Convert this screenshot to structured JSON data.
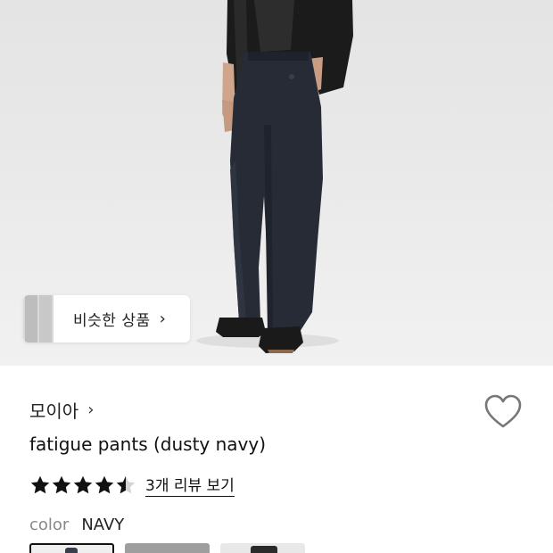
{
  "hero": {
    "image": "product-photo-person-in-navy-pants"
  },
  "similar": {
    "label": "비슷한 상품",
    "arrow": "›"
  },
  "brand": {
    "name": "모이아",
    "arrow": "›"
  },
  "product": {
    "title": "fatigue pants (dusty navy)"
  },
  "rating": {
    "stars": 4.5,
    "reviews_link": "3개 리뷰 보기"
  },
  "color": {
    "label": "color",
    "value": "NAVY",
    "options": [
      "navy-swatch",
      "gray-swatch",
      "black-swatch"
    ]
  },
  "colors": {
    "text": "#111111",
    "muted": "#888888",
    "pants": "#272b36"
  }
}
